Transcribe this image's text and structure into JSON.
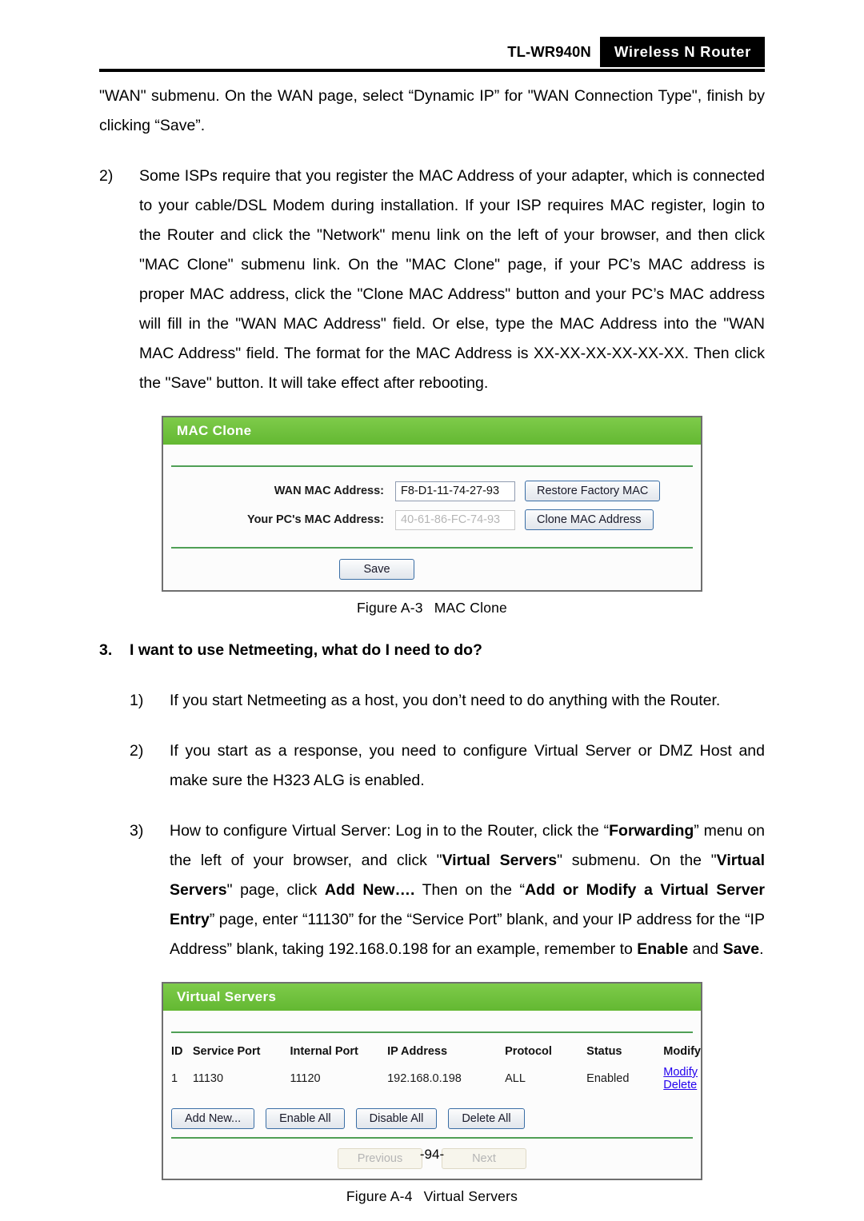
{
  "header": {
    "model": "TL-WR940N",
    "badge": "Wireless N Router"
  },
  "body": {
    "para_continued": "\"WAN\" submenu. On the WAN page, select “Dynamic IP” for \"WAN Connection Type\", finish by clicking “Save”.",
    "item2_marker": "2)",
    "item2_text": "Some ISPs require that you register the MAC Address of your adapter, which is connected to your cable/DSL Modem during installation. If your ISP requires MAC register, login to the Router and click the \"Network\" menu link on the left of your browser, and then click \"MAC Clone\" submenu link. On the \"MAC Clone\" page, if your PC’s MAC address is proper MAC address, click the \"Clone MAC Address\" button and your PC’s MAC address will fill in the \"WAN MAC Address\" field. Or else, type the MAC Address into the \"WAN MAC Address\" field. The format for the MAC Address is XX-XX-XX-XX-XX-XX. Then click the \"Save\" button. It will take effect after rebooting.",
    "question3_num": "3.",
    "question3_text": "I want to use Netmeeting, what do I need to do?",
    "q3_item1_marker": "1)",
    "q3_item1_text": "If you start Netmeeting as a host, you don’t need to do anything with the Router.",
    "q3_item2_marker": "2)",
    "q3_item2_text": "If you start as a response, you need to configure Virtual Server or DMZ Host and make sure the H323 ALG is enabled.",
    "q3_item3_marker": "3)",
    "q3_item3_parts": [
      {
        "text": "How to configure Virtual Server: Log in to the Router, click the “",
        "bold": false
      },
      {
        "text": "Forwarding",
        "bold": true
      },
      {
        "text": "” menu on the left of your browser, and click \"",
        "bold": false
      },
      {
        "text": "Virtual Servers",
        "bold": true
      },
      {
        "text": "\" submenu. On the \"",
        "bold": false
      },
      {
        "text": "Virtual Servers",
        "bold": true
      },
      {
        "text": "\" page, click ",
        "bold": false
      },
      {
        "text": "Add New….",
        "bold": true
      },
      {
        "text": " Then on the “",
        "bold": false
      },
      {
        "text": "Add or Modify a Virtual Server Entry",
        "bold": true
      },
      {
        "text": "” page, enter “11130” for the “Service Port” blank, and your IP address for the “IP Address” blank, taking 192.168.0.198 for an example, remember to ",
        "bold": false
      },
      {
        "text": "Enable",
        "bold": true
      },
      {
        "text": " and ",
        "bold": false
      },
      {
        "text": "Save",
        "bold": true
      },
      {
        "text": ".",
        "bold": false
      }
    ]
  },
  "mac_clone_panel": {
    "title": "MAC Clone",
    "rows": [
      {
        "label": "WAN MAC Address:",
        "value": "F8-D1-11-74-27-93",
        "disabled": false,
        "button": "Restore Factory MAC"
      },
      {
        "label": "Your PC's MAC Address:",
        "value": "40-61-86-FC-74-93",
        "disabled": true,
        "button": "Clone MAC Address"
      }
    ],
    "save_button": "Save"
  },
  "figure_a3": {
    "number": "Figure A-3",
    "title": "MAC Clone"
  },
  "virtual_servers_panel": {
    "title": "Virtual Servers",
    "columns": [
      "ID",
      "Service Port",
      "Internal Port",
      "IP Address",
      "Protocol",
      "Status",
      "Modify"
    ],
    "rows": [
      {
        "id": "1",
        "service_port": "11130",
        "internal_port": "11120",
        "ip_address": "192.168.0.198",
        "protocol": "ALL",
        "status": "Enabled",
        "modify_link": "Modify",
        "delete_link": "Delete"
      }
    ],
    "buttons": [
      "Add New...",
      "Enable All",
      "Disable All",
      "Delete All"
    ],
    "pager": {
      "previous": "Previous",
      "next": "Next"
    }
  },
  "figure_a4": {
    "number": "Figure A-4",
    "title": "Virtual Servers"
  },
  "footer": {
    "page_number": "-94-"
  },
  "colors": {
    "panel_green": "#6ec23a",
    "separator_green": "#4f9f55",
    "link_blue": "#2200ee",
    "badge_black": "#000000"
  }
}
